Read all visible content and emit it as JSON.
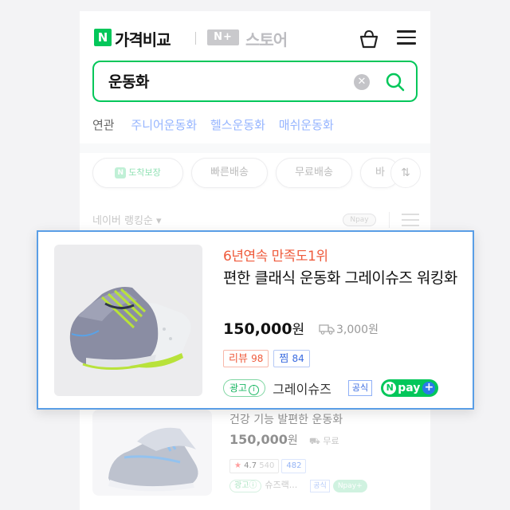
{
  "header": {
    "logo_letter": "N",
    "brand": "가격비교",
    "nplus_logo": "N+",
    "store_label": "스토어"
  },
  "search": {
    "query": "운동화",
    "clear_symbol": "✕"
  },
  "related": {
    "label": "연관",
    "items": [
      "주니어운동화",
      "헬스운동화",
      "매쉬운동화"
    ]
  },
  "filters": {
    "badge_letter": "N",
    "chips": [
      "도착보장",
      "빠른배송",
      "무료배송",
      "바"
    ]
  },
  "sort": {
    "label": "네이버 랭킹순",
    "chevron": "▾",
    "npay_toggle": "Npay"
  },
  "featured": {
    "promo": "6년연속 만족도1위",
    "title": "편한 클래식 운동화 그레이슈즈 워킹화",
    "price": "150,000",
    "price_unit": "원",
    "shipping_fee": "3,000원",
    "review_label": "리뷰",
    "review_count": "98",
    "wish_label": "찜",
    "wish_count": "84",
    "ad_label": "광고",
    "info_symbol": "i",
    "mall_name": "그레이슈즈",
    "official_badge": "공식",
    "npay_n": "N",
    "npay_text": "pay",
    "npay_plus": "+"
  },
  "background_item": {
    "title": "건강 기능 발편한 운동화",
    "price": "150,000",
    "price_unit": "원",
    "shipping": "무료",
    "star": "★",
    "rating": "4.7",
    "review_count": "540",
    "wish_count": "482",
    "ad_label": "광고ⓘ",
    "mall_name": "슈즈랙...",
    "official_badge": "공식",
    "npay": "Npay+"
  },
  "colors": {
    "naver_green": "#03c75a",
    "highlight_border": "#5a9ee6",
    "promo_red": "#ef5b3c",
    "link_blue": "#96b5ff",
    "wish_blue": "#3b6ce0"
  }
}
